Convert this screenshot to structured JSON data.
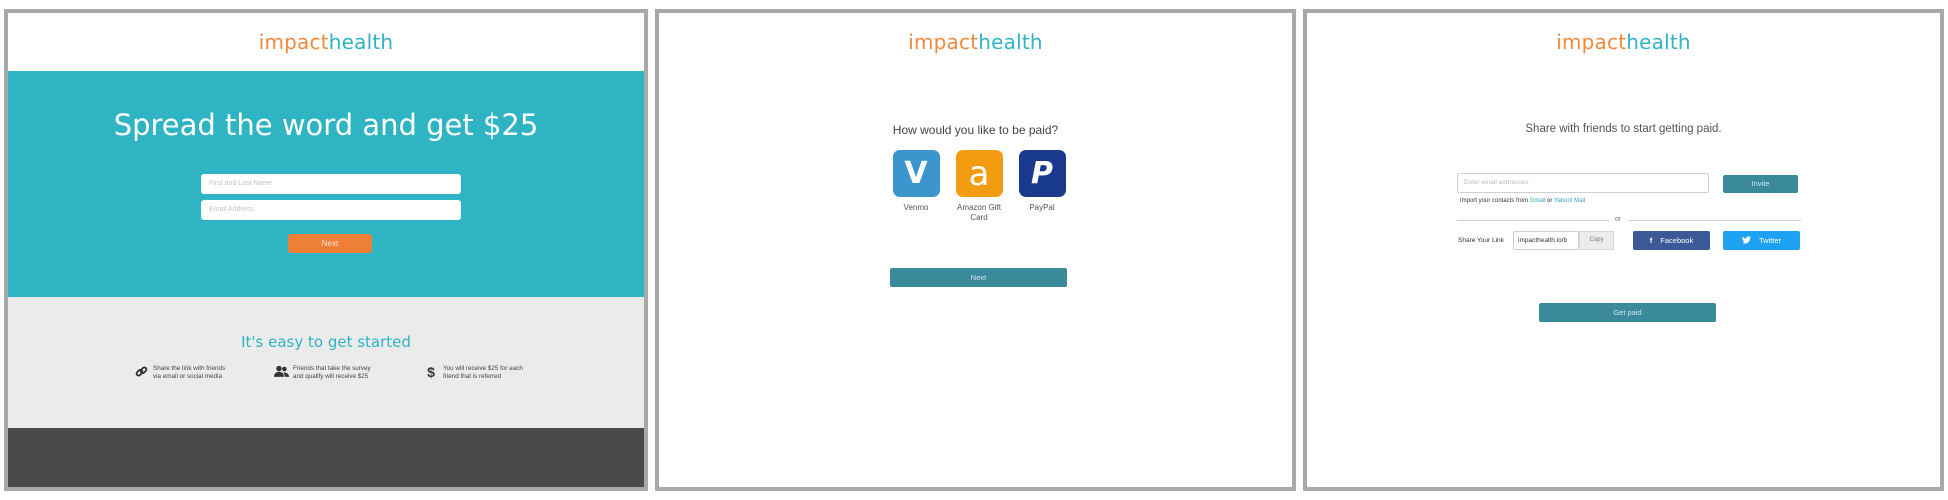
{
  "brand": {
    "part1": "impact",
    "part2": "health",
    "color_orange": "#ef8a3c",
    "color_teal": "#2fb4c4"
  },
  "screen1": {
    "headline": "Spread the word and get $25",
    "name_placeholder": "First and Last Name",
    "email_placeholder": "Email Address",
    "next_label": "Next",
    "steps_title": "It's easy to get started",
    "steps": [
      {
        "icon": "link-icon",
        "text": "Share the link with friends\nvia email or social media"
      },
      {
        "icon": "users-icon",
        "text": "Friends that take the survey\nand qualify will receive $25"
      },
      {
        "icon": "dollar-icon",
        "text": "You will receive $25 for each\nfriend that is referred"
      }
    ]
  },
  "screen2": {
    "question": "How would you like to be paid?",
    "options": [
      {
        "label": "Venmo",
        "glyph": "V",
        "icon": "venmo-icon",
        "color": "#3d95ce"
      },
      {
        "label": "Amazon Gift\nCard",
        "glyph": "a",
        "icon": "amazon-icon",
        "color": "#f39c12"
      },
      {
        "label": "PayPal",
        "glyph": "P",
        "icon": "paypal-icon",
        "color": "#1a3a8f"
      }
    ],
    "next_label": "Next"
  },
  "screen3": {
    "heading": "Share with friends to start getting paid.",
    "email_placeholder": "Enter email addresses",
    "invite_label": "Invite",
    "import_text": "Import your contacts from ",
    "import_gmail": "Gmail",
    "import_or": " or ",
    "import_yahoo": "Yahoo! Mail",
    "or_label": "or",
    "share_link_label": "Share Your Link",
    "link_value": "impacthealth.io/b",
    "copy_label": "Copy",
    "facebook_label": "Facebook",
    "twitter_label": "Twitter",
    "get_paid_label": "Get paid"
  }
}
